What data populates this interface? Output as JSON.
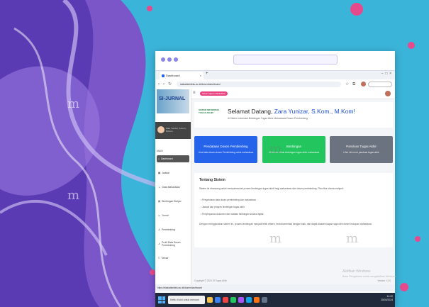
{
  "browser": {
    "tab_title": "Dashboard",
    "url": "siakadstmikku.ac.id/dosen/dashboard"
  },
  "sidebar": {
    "logo_text": "SI-JURNAL",
    "user_name": "Zara Yunizar, S.Kom., M.Kom",
    "menu_label": "MAIN",
    "items": [
      {
        "label": "Dashboard",
        "icon": "home-icon"
      },
      {
        "label": "Jadwal",
        "icon": "calendar-icon"
      },
      {
        "label": "Data Mahasiswa",
        "icon": "users-icon"
      },
      {
        "label": "Bimbingan Skripsi",
        "icon": "book-icon"
      },
      {
        "label": "Jurnal",
        "icon": "document-icon"
      },
      {
        "label": "Pembimbing",
        "icon": "user-icon"
      },
      {
        "label": "Profil Data Dosen Pembimbing",
        "icon": "profile-icon"
      },
      {
        "label": "Keluar",
        "icon": "logout-icon"
      }
    ]
  },
  "topbar": {
    "badge": "Tahun Ajaran 2023/2024"
  },
  "welcome": {
    "greeting": "Selamat Datang,",
    "name": "Zara Yunizar, S.Kom., M.Kom!",
    "subtitle": "di Sistem Informasi Bimbingan Tugas Akhir Mahasiswa Dosen Pembimbing",
    "logo_text": "SISTEM INFORMASI TUGAS AKHIR"
  },
  "cards": [
    {
      "title": "Pendataan Dosen Pembimbing",
      "desc": "Lihat data dosen-dosen Pembimbing untuk mahasiswa",
      "color": "#2563eb"
    },
    {
      "title": "Bimbingan",
      "desc": "Lihat dan kelola bimbingan tugas akhir mahasiswa",
      "color": "#22c55e"
    },
    {
      "title": "Panduan Tugas Akhir",
      "desc": "Lihat informasi panduan tugas akhir",
      "color": "#6b7280"
    }
  ],
  "about": {
    "title": "Tentang Sistem",
    "intro": "Sistem ini dirancang untuk mempermudah proses bimbingan tugas akhir bagi mahasiswa dan dosen pembimbing. Fitur-fitur utama meliputi:",
    "bullets": [
      "Pengelolaan data dosen pembimbing dan mahasiswa",
      "Jadwal dan progres bimbingan tugas akhir",
      "Penyimpanan dokumen dan catatan bimbingan secara digital"
    ],
    "closing": "Dengan menggunakan sistem ini, proses bimbingan menjadi lebih efisien, terdokumentasi dengan baik, dan dapat diakses kapan saja oleh dosen maupun mahasiswa."
  },
  "footer": {
    "left": "Copyright © 2024 SI Tugas Akhir",
    "right": "Version 1.0.0"
  },
  "statusbar": "https://siakadstmikku.ac.id/dosen/dashboard",
  "taskbar": {
    "search_placeholder": "Ketik di sini untuk mencari",
    "time": "14:20",
    "date": "25/03/2024"
  },
  "activate_windows": {
    "line1": "Aktifkan Windows",
    "line2": "Buka Pengaturan untuk mengaktifkan Windows."
  },
  "watermark": "m"
}
